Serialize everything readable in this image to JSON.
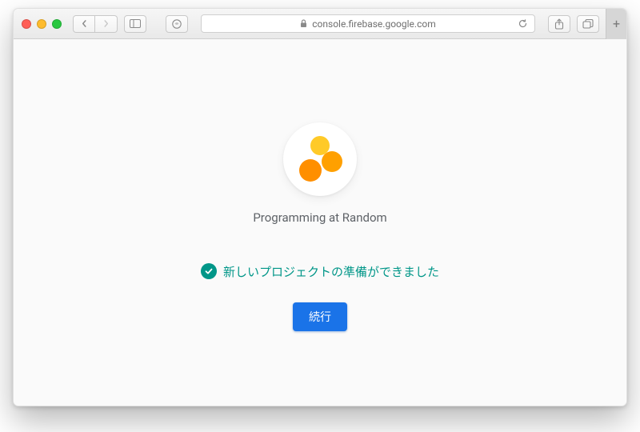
{
  "browser": {
    "url": "console.firebase.google.com"
  },
  "main": {
    "project_name": "Programming at Random",
    "ready_message": "新しいプロジェクトの準備ができました",
    "continue_label": "続行"
  }
}
